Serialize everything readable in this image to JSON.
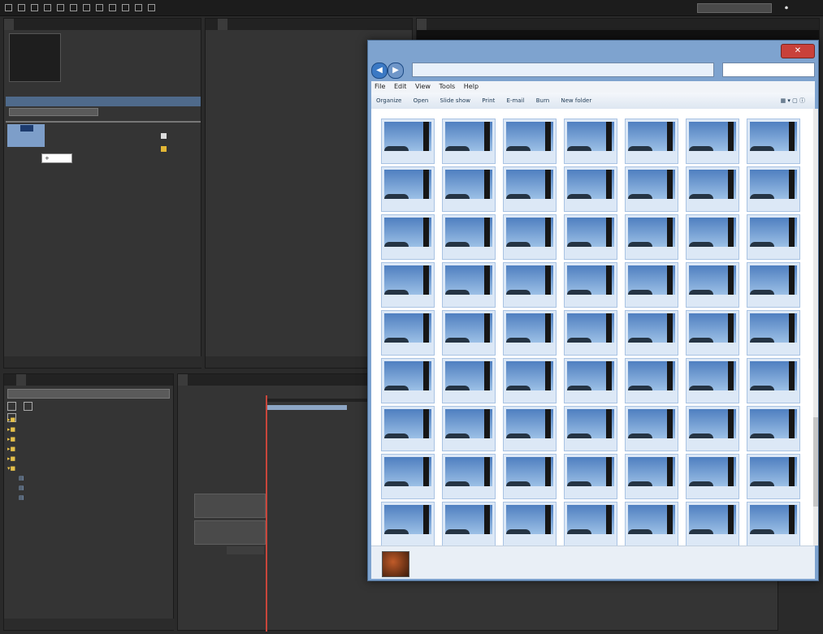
{
  "app": {
    "workspace_label": "",
    "workspace_value": "",
    "search_label": ""
  },
  "top_panels": {
    "project_tabs": [
      "",
      ""
    ],
    "source_tabs": [
      "",
      "",
      "",
      ""
    ],
    "program_tab": "",
    "source_status": ""
  },
  "effects_panel": {
    "tabs": [
      "",
      "",
      ""
    ],
    "categories": [
      "",
      "",
      "",
      "",
      ""
    ],
    "custom_bin": "",
    "custom_items": [
      "",
      "",
      ""
    ]
  },
  "timeline": {
    "tabs": [
      "",
      ""
    ],
    "timecode": "",
    "ruler": [
      "",
      ""
    ]
  },
  "explorer": {
    "menu": [
      "File",
      "Edit",
      "View",
      "Tools",
      "Help"
    ],
    "toolbar": [
      "Organize",
      "Open",
      "Slide show",
      "Print",
      "E-mail",
      "Burn",
      "New folder"
    ],
    "address": "",
    "search_placeholder": "",
    "thumb_names": [
      "",
      "",
      "",
      "",
      "",
      "",
      "",
      "",
      "",
      "",
      "",
      "",
      "",
      "",
      "",
      "",
      "",
      "",
      "",
      "",
      "",
      "",
      "",
      "",
      "",
      "",
      "",
      "",
      "",
      "",
      "",
      "",
      "",
      "",
      "",
      "",
      "",
      "",
      "",
      "",
      "",
      "",
      "",
      "",
      "",
      "",
      "",
      "",
      "",
      "",
      "",
      "",
      "",
      "",
      "",
      "",
      "",
      "",
      "",
      "",
      "",
      "",
      ""
    ],
    "status_text": "",
    "status_sub": ""
  },
  "colors": {
    "dark_bg": "#2a2a2a",
    "panel_bg": "#343434",
    "accent_orange": "#e8a21b",
    "selection_blue": "#7d9ec9",
    "explorer_frame": "#7ea3cf"
  }
}
